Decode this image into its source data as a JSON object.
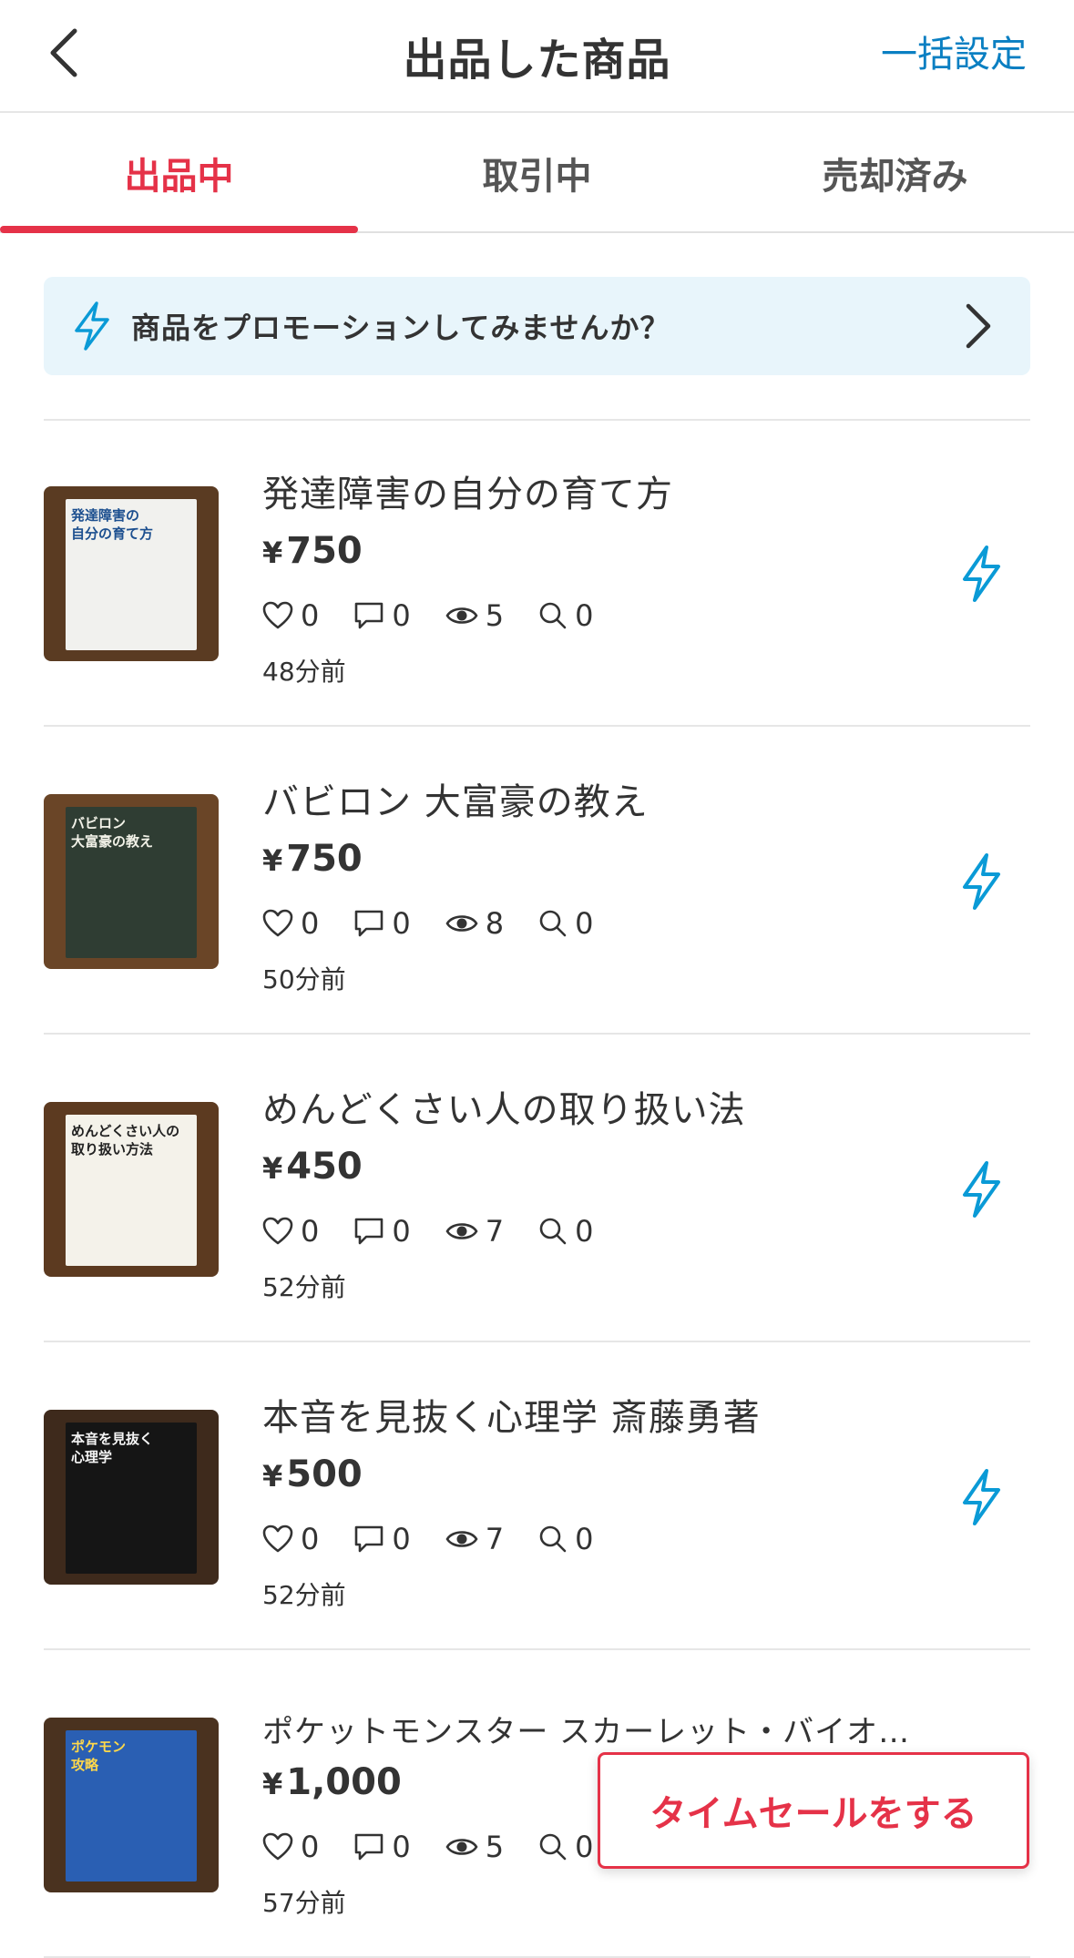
{
  "header": {
    "title": "出品した商品",
    "bulk_settings": "一括設定"
  },
  "tabs": [
    {
      "label": "出品中",
      "active": true
    },
    {
      "label": "取引中",
      "active": false
    },
    {
      "label": "売却済み",
      "active": false
    }
  ],
  "promo": {
    "text": "商品をプロモーションしてみませんか？"
  },
  "items": [
    {
      "title": "発達障害の自分の育て方",
      "currency": "¥",
      "price": "750",
      "likes": "0",
      "comments": "0",
      "views": "5",
      "searches": "0",
      "time": "48分前",
      "cover_lines": [
        "発達障害の",
        "自分の育て方"
      ]
    },
    {
      "title": "バビロン 大富豪の教え",
      "currency": "¥",
      "price": "750",
      "likes": "0",
      "comments": "0",
      "views": "8",
      "searches": "0",
      "time": "50分前",
      "cover_lines": [
        "バビロン",
        "大富豪の教え"
      ]
    },
    {
      "title": "めんどくさい人の取り扱い法",
      "currency": "¥",
      "price": "450",
      "likes": "0",
      "comments": "0",
      "views": "7",
      "searches": "0",
      "time": "52分前",
      "cover_lines": [
        "めんどくさい人の",
        "取り扱い方法"
      ]
    },
    {
      "title": "本音を見抜く心理学 斎藤勇著",
      "currency": "¥",
      "price": "500",
      "likes": "0",
      "comments": "0",
      "views": "7",
      "searches": "0",
      "time": "52分前",
      "cover_lines": [
        "本音を見抜く",
        "心理学"
      ]
    },
    {
      "title": "ポケットモンスター スカーレット・バイオ…",
      "currency": "¥",
      "price": "1,000",
      "likes": "0",
      "comments": "0",
      "views": "5",
      "searches": "0",
      "time": "57分前",
      "cover_lines": [
        "ポケモン",
        "攻略"
      ]
    }
  ],
  "timesale_button": "タイムセールをする",
  "colors": {
    "accent_red": "#e53248",
    "link_blue": "#0a7fc2",
    "promo_bg": "#e8f5fb"
  }
}
